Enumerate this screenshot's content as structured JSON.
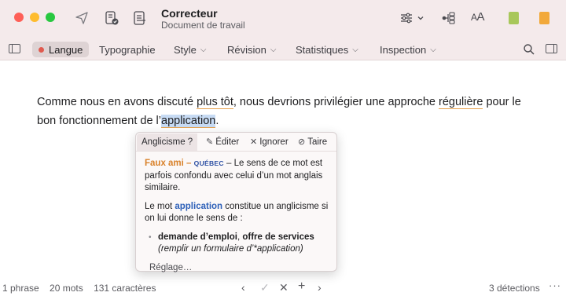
{
  "window": {
    "title": "Correcteur",
    "subtitle": "Document de travail"
  },
  "toolbar": {
    "tabs": [
      {
        "label": "Langue",
        "active": true
      },
      {
        "label": "Typographie"
      },
      {
        "label": "Style"
      },
      {
        "label": "Révision"
      },
      {
        "label": "Statistiques"
      },
      {
        "label": "Inspection"
      }
    ]
  },
  "document": {
    "seg1": "Comme nous en avons discuté ",
    "seg2": "plus tôt",
    "seg3": ", nous devrions privilégier une approche ",
    "seg4": "régulière",
    "seg5": " pour le bon fonctionnement de l’",
    "seg6": "application",
    "seg7": "."
  },
  "popover": {
    "title": "Anglicisme ?",
    "actions": {
      "edit": "Éditer",
      "ignore": "Ignorer",
      "silence": "Taire"
    },
    "faux_ami": "Faux ami –",
    "region": "QUÉBEC",
    "desc": " – Le sens de ce mot est parfois confondu avec celui d’un mot anglais similaire.",
    "p2_a": "Le mot ",
    "p2_kw": "application",
    "p2_b": " constitue un anglicisme si on lui donne le sens de :",
    "bullet_strong_1": "demande d’emploi",
    "bullet_sep": ", ",
    "bullet_strong_2": "offre de services",
    "bullet_example": "(remplir un formulaire d’*application)",
    "settings": "Réglage…"
  },
  "status": {
    "sentences": "1 phrase",
    "words": "20 mots",
    "chars": "131 caractères",
    "detections": "3 détections"
  },
  "colors": {
    "titlebar_bg": "#f4eaeb",
    "underline": "#e8a04a",
    "selection": "#c7dbf4",
    "faux_ami": "#d9822b",
    "keyword": "#2c5fb8"
  }
}
